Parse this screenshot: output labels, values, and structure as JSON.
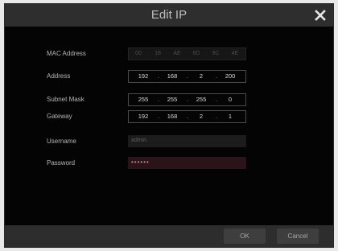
{
  "dialog": {
    "title": "Edit IP",
    "close_icon": "close-icon"
  },
  "fields": {
    "mac": {
      "label": "MAC Address",
      "segments": [
        "00",
        "18",
        "AE",
        "8D",
        "9C",
        "4E"
      ]
    },
    "address": {
      "label": "Address",
      "octets": [
        "192",
        "168",
        "2",
        "200"
      ]
    },
    "subnet": {
      "label": "Subnet Mask",
      "octets": [
        "255",
        "255",
        "255",
        "0"
      ]
    },
    "gateway": {
      "label": "Gateway",
      "octets": [
        "192",
        "168",
        "2",
        "1"
      ]
    },
    "username": {
      "label": "Username",
      "value": "admin"
    },
    "password": {
      "label": "Password",
      "value": "••••••"
    }
  },
  "footer": {
    "ok_label": "OK",
    "cancel_label": "Cancel"
  }
}
